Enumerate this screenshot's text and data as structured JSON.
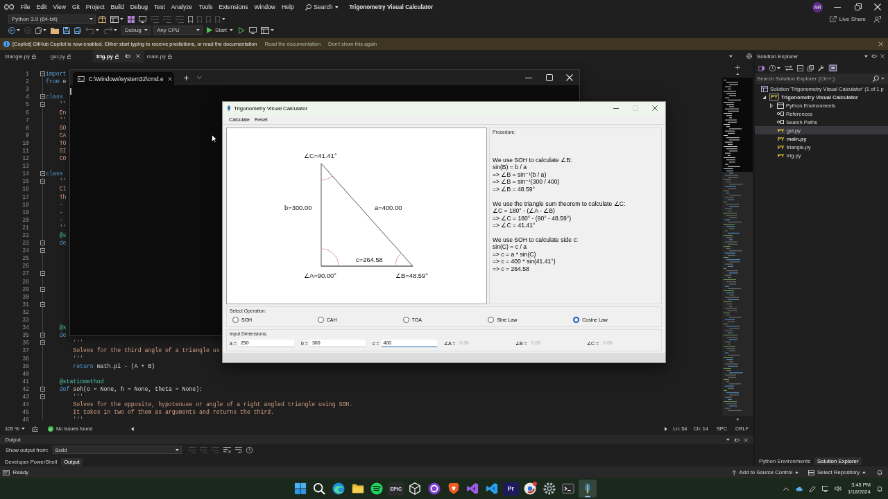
{
  "title_bar": {
    "menu": [
      "File",
      "Edit",
      "View",
      "Git",
      "Project",
      "Build",
      "Debug",
      "Test",
      "Analyze",
      "Tools",
      "Extensions",
      "Window",
      "Help"
    ],
    "search": "Search",
    "solution_name": "Trigonometry Visual Calculator",
    "account": "AR"
  },
  "toolbar": {
    "rows": [
      {
        "items": [
          {
            "kind": "dropdown",
            "label": "Python 3.9 (64-bit)",
            "disabled": false,
            "menu": true
          },
          {
            "kind": "package",
            "disabled": false,
            "menu": false
          },
          {
            "kind": "window",
            "disabled": false,
            "menu": true
          },
          {
            "kind": "grid",
            "disabled": false,
            "menu": false
          },
          {
            "kind": "monitor",
            "disabled": false,
            "menu": false
          },
          {
            "kind": "lines",
            "disabled": true,
            "menu": false
          },
          {
            "kind": "lines",
            "disabled": true,
            "menu": false
          },
          {
            "kind": "lines",
            "disabled": true,
            "menu": false
          },
          {
            "kind": "bookmark",
            "disabled": false,
            "menu": false
          },
          {
            "kind": "bookmark",
            "disabled": true,
            "menu": false
          },
          {
            "kind": "bookmark",
            "disabled": true,
            "menu": false
          },
          {
            "kind": "bookmark",
            "disabled": true,
            "menu": true
          }
        ]
      },
      {
        "items": [
          {
            "kind": "back",
            "disabled": false,
            "menu": true
          },
          {
            "kind": "forward",
            "disabled": true,
            "menu": false
          },
          {
            "kind": "docs",
            "disabled": false,
            "menu": true
          },
          {
            "kind": "folder",
            "disabled": false,
            "menu": false
          },
          {
            "kind": "save",
            "disabled": false,
            "menu": false
          },
          {
            "kind": "saveall",
            "disabled": false,
            "menu": false
          },
          {
            "kind": "undo",
            "disabled": true,
            "menu": true
          },
          {
            "kind": "redo",
            "disabled": true,
            "menu": true
          },
          {
            "kind": "dropdown",
            "label": "Debug",
            "disabled": false,
            "menu": true
          },
          {
            "kind": "dropdown",
            "label": "Any CPU",
            "disabled": false,
            "menu": true
          },
          {
            "kind": "start",
            "label": "Start",
            "disabled": false,
            "menu": true
          },
          {
            "kind": "run",
            "disabled": false,
            "menu": false
          },
          {
            "kind": "monitor",
            "disabled": false,
            "menu": false
          },
          {
            "kind": "window",
            "disabled": false,
            "menu": true
          }
        ]
      }
    ],
    "live_share": "Live Share"
  },
  "info_bar": {
    "message": "[Copilot] GitHub Copilot is now enabled. Either start typing to receive predictions, or read the documentation",
    "links": [
      "Read the documentation",
      "Don't show this again"
    ]
  },
  "document_tabs": [
    {
      "label": "triangle.py",
      "selected": false
    },
    {
      "label": "gui.py",
      "selected": false
    },
    {
      "label": "trig.py",
      "selected": true
    },
    {
      "label": "main.py",
      "selected": false
    }
  ],
  "editor": {
    "lines": [
      {
        "number": "1",
        "foldable": true,
        "tokens": [
          {
            "text": "import",
            "kind": "keyword"
          }
        ]
      },
      {
        "number": "2",
        "foldable": false,
        "tokens": [
          {
            "text": "from",
            "kind": "keyword"
          },
          {
            "text": " e",
            "kind": "plain"
          }
        ]
      },
      {
        "number": "3",
        "foldable": false
      },
      {
        "number": "4",
        "foldable": true,
        "tokens": [
          {
            "text": "class",
            "kind": "keyword"
          }
        ],
        "children": [
          {
            "number": "5",
            "foldable": true,
            "tokens": [
              {
                "text": "''",
                "kind": "string"
              }
            ]
          },
          {
            "number": "6",
            "foldable": false,
            "tokens": [
              {
                "text": "En",
                "kind": "string"
              }
            ]
          },
          {
            "number": "7",
            "foldable": false,
            "tokens": [
              {
                "text": "''",
                "kind": "string"
              }
            ]
          },
          {
            "number": "8",
            "foldable": false,
            "tokens": [
              {
                "text": "SO",
                "kind": "string"
              }
            ]
          },
          {
            "number": "9",
            "foldable": false,
            "tokens": [
              {
                "text": "CA",
                "kind": "string"
              }
            ]
          },
          {
            "number": "10",
            "foldable": false,
            "tokens": [
              {
                "text": "TO",
                "kind": "string"
              }
            ]
          },
          {
            "number": "11",
            "foldable": false,
            "tokens": [
              {
                "text": "SI",
                "kind": "string"
              }
            ]
          },
          {
            "number": "12",
            "foldable": false,
            "tokens": [
              {
                "text": "CO",
                "kind": "string"
              }
            ]
          }
        ]
      },
      {
        "number": "13",
        "foldable": false
      },
      {
        "number": "14",
        "foldable": true,
        "tokens": [
          {
            "text": "class",
            "kind": "keyword"
          }
        ],
        "children": [
          {
            "number": "15",
            "foldable": true,
            "tokens": [
              {
                "text": "''",
                "kind": "string"
              }
            ]
          },
          {
            "number": "16",
            "foldable": false,
            "tokens": [
              {
                "text": "Cl",
                "kind": "string"
              }
            ]
          },
          {
            "number": "17",
            "foldable": false,
            "tokens": [
              {
                "text": "Th",
                "kind": "string"
              }
            ]
          },
          {
            "number": "18",
            "foldable": false,
            "tokens": [
              {
                "text": "-",
                "kind": "string"
              }
            ]
          },
          {
            "number": "19",
            "foldable": false,
            "tokens": [
              {
                "text": "-",
                "kind": "string"
              }
            ]
          },
          {
            "number": "20",
            "foldable": false,
            "tokens": [
              {
                "text": "-",
                "kind": "string"
              }
            ]
          },
          {
            "number": "21",
            "foldable": false,
            "tokens": [
              {
                "text": "''",
                "kind": "string"
              }
            ]
          },
          {
            "number": "22",
            "foldable": false,
            "tokens": [
              {
                "text": "@s",
                "kind": "decorator"
              }
            ]
          },
          {
            "number": "23",
            "foldable": true,
            "tokens": [
              {
                "text": "de",
                "kind": "keyword"
              }
            ],
            "children": [
              {
                "number": "24",
                "foldable": true
              },
              {
                "number": "25",
                "foldable": false
              },
              {
                "number": "26",
                "foldable": false
              },
              {
                "number": "27",
                "foldable": true
              },
              {
                "number": "28",
                "foldable": false
              },
              {
                "number": "29",
                "foldable": true
              },
              {
                "number": "30",
                "foldable": false
              },
              {
                "number": "31",
                "foldable": true
              },
              {
                "number": "32",
                "foldable": false
              },
              {
                "number": "33",
                "foldable": false
              }
            ]
          },
          {
            "number": "34",
            "foldable": false,
            "tokens": [
              {
                "text": "@s",
                "kind": "decorator"
              }
            ]
          },
          {
            "number": "35",
            "foldable": true,
            "tokens": [
              {
                "text": "de",
                "kind": "keyword"
              }
            ],
            "children": [
              {
                "number": "36",
                "foldable": true,
                "tokens": [
                  {
                    "text": "'''",
                    "kind": "string"
                  }
                ]
              },
              {
                "number": "37",
                "foldable": false,
                "tokens": [
                  {
                    "text": "Solves for the third angle of a triangle us",
                    "kind": "string"
                  }
                ]
              },
              {
                "number": "38",
                "foldable": false,
                "tokens": [
                  {
                    "text": "'''",
                    "kind": "string"
                  }
                ]
              },
              {
                "number": "39",
                "foldable": false,
                "tokens": [
                  {
                    "text": "return",
                    "kind": "keyword"
                  },
                  {
                    "text": " math.pi - (A + B)",
                    "kind": "plain"
                  }
                ]
              }
            ]
          },
          {
            "number": "40",
            "foldable": false
          },
          {
            "number": "41",
            "foldable": false,
            "tokens": [
              {
                "text": "@staticmethod",
                "kind": "decorator"
              }
            ]
          },
          {
            "number": "42",
            "foldable": true,
            "tokens": [
              {
                "text": "def",
                "kind": "keyword"
              },
              {
                "text": " soh(o = None, h = None, theta = None):",
                "kind": "plain"
              }
            ],
            "children": [
              {
                "number": "43",
                "foldable": true,
                "tokens": [
                  {
                    "text": "'''",
                    "kind": "string"
                  }
                ]
              },
              {
                "number": "44",
                "foldable": false,
                "tokens": [
                  {
                    "text": "Solves for the opposite, hypotenuse or angle of a right angled triangle using SOH.",
                    "kind": "string"
                  }
                ]
              },
              {
                "number": "45",
                "foldable": false,
                "tokens": [
                  {
                    "text": "It takes in two of them as arguments and returns the third.",
                    "kind": "string"
                  }
                ]
              },
              {
                "number": "46",
                "foldable": false,
                "tokens": [
                  {
                    "text": "'''",
                    "kind": "string"
                  }
                ]
              }
            ]
          }
        ]
      }
    ]
  },
  "editor_status": {
    "zoom": "105 %",
    "issues": "No issues found",
    "line": "Ln: 54",
    "column": "Ch: 14",
    "indentation": "SPC",
    "line_ending": "CRLF"
  },
  "cmd_window": {
    "tab": "C:\\Windows\\system32\\cmd.e"
  },
  "calculator": {
    "title": "Trigonometry Visual Calculator",
    "controls": [
      {
        "kind": "minimize",
        "disabled": false
      },
      {
        "kind": "maximize",
        "disabled": true
      },
      {
        "kind": "close",
        "disabled": false
      }
    ],
    "menu": [
      "Calculate",
      "Reset"
    ],
    "diagram": {
      "angles": [
        "∠A=90.00°",
        "∠B=48.59°",
        "∠C=41.41°"
      ],
      "sides": [
        "a=400.00",
        "b=300.00",
        "c=264.58"
      ]
    },
    "procedure": {
      "label": "Procedure:",
      "blocks": [
        [
          "We use SOH to calculate ∠B:",
          "sin(B) = b / a",
          "=> ∠B = sin⁻¹(b / a)",
          "=> ∠B = sin⁻¹(300 / 400)",
          "=> ∠B = 48.59°"
        ],
        [
          "We use the triangle sum theorem to calculate ∠C:",
          "∠C = 180° - (∠A - ∠B)",
          "=> ∠C = 180° - (90° - 48.59°)",
          "=> ∠C = 41.41°"
        ],
        [
          "We use SOH to calculate side c:",
          "sin(C) = c / a",
          "=> c = a * sin(C)",
          "=> c = 400 * sin(41.41°)",
          "=> c = 264.58"
        ]
      ]
    },
    "operation": {
      "label": "Select Operation:",
      "options": [
        {
          "label": "SOH",
          "selected": false
        },
        {
          "label": "CAH",
          "selected": false
        },
        {
          "label": "TOA",
          "selected": false
        },
        {
          "label": "Sine Law",
          "selected": false
        },
        {
          "label": "Cosine Law",
          "selected": true
        }
      ]
    },
    "dimensions": {
      "label": "Input Dimensions:",
      "fields": [
        {
          "label": "a =",
          "value": "250",
          "focused": false,
          "disabled": false
        },
        {
          "label": "b =",
          "value": "300",
          "focused": false,
          "disabled": false
        },
        {
          "label": "c =",
          "value": "400",
          "focused": true,
          "disabled": false
        },
        {
          "label": "∠A =",
          "value": "0.00",
          "focused": false,
          "disabled": true
        },
        {
          "label": "∠B =",
          "value": "0.00",
          "focused": false,
          "disabled": true
        },
        {
          "label": "∠C =",
          "value": "0.00",
          "focused": false,
          "disabled": true
        }
      ]
    }
  },
  "output": {
    "title": "Output",
    "source_label": "Show output from:",
    "source": "Build",
    "tools": [
      {
        "kind": "lines",
        "disabled": true
      },
      {
        "kind": "lines",
        "disabled": true
      },
      {
        "kind": "lines",
        "disabled": true
      },
      {
        "kind": "clear",
        "disabled": false
      },
      {
        "kind": "wrap",
        "disabled": false
      },
      {
        "kind": "clock",
        "disabled": false
      }
    ],
    "tabs": [
      {
        "label": "Developer PowerShell",
        "selected": false
      },
      {
        "label": "Output",
        "selected": true
      }
    ]
  },
  "solution_explorer": {
    "title": "Solution Explorer",
    "tools": [
      {
        "kind": "solution",
        "on": false,
        "menu": false
      },
      {
        "kind": "history",
        "on": false,
        "menu": true
      },
      {
        "kind": "sync",
        "on": false,
        "menu": false
      },
      {
        "kind": "collapse",
        "on": false,
        "menu": false
      },
      {
        "kind": "pages",
        "on": false,
        "menu": false
      },
      {
        "kind": "wrench",
        "on": false,
        "menu": false
      },
      {
        "kind": "preview",
        "on": true,
        "menu": false
      }
    ],
    "search": {
      "placeholder": "Search Solution Explorer (Ctrl+;)"
    },
    "tree": [
      {
        "label": "Solution 'Trigonometry Visual Calculator' (1 of 1 p",
        "kind": "solution",
        "selected": false,
        "startup": false,
        "children": [
          {
            "label": "Trigonometry Visual Calculator",
            "kind": "project",
            "badge": "PY",
            "expanded": true,
            "selected": false,
            "startup": true,
            "children": [
              {
                "label": "Python Environments",
                "kind": "environments",
                "expanded": false,
                "selected": false,
                "startup": false
              },
              {
                "label": "References",
                "kind": "references",
                "selected": false,
                "startup": false
              },
              {
                "label": "Search Paths",
                "kind": "references",
                "selected": false,
                "startup": false
              },
              {
                "label": "gui.py",
                "kind": "file",
                "badge": "PY",
                "selected": true,
                "startup": false
              },
              {
                "label": "main.py",
                "kind": "file",
                "badge": "PY",
                "selected": false,
                "startup": true
              },
              {
                "label": "triangle.py",
                "kind": "file",
                "badge": "PY",
                "selected": false,
                "startup": false
              },
              {
                "label": "trig.py",
                "kind": "file",
                "badge": "PY",
                "selected": false,
                "startup": false
              }
            ]
          }
        ]
      }
    ],
    "tabs": [
      {
        "label": "Python Environments",
        "selected": false
      },
      {
        "label": "Solution Explorer",
        "selected": true
      }
    ]
  },
  "status_bar": {
    "status": "Ready",
    "source_control": "Add to Source Control",
    "repository": "Select Repository"
  },
  "taskbar": {
    "apps": [
      {
        "kind": "windows",
        "selected": false,
        "notification": false
      },
      {
        "kind": "search",
        "selected": false,
        "notification": false
      },
      {
        "kind": "swirl",
        "selected": false,
        "notification": false
      },
      {
        "kind": "folder",
        "selected": false,
        "notification": false
      },
      {
        "kind": "waves",
        "selected": false,
        "notification": false
      },
      {
        "kind": "tile",
        "text": "EPIC",
        "color": "#2b2b2b",
        "selected": false,
        "notification": false
      },
      {
        "kind": "cube",
        "selected": false,
        "notification": false
      },
      {
        "kind": "ring",
        "selected": false,
        "notification": false
      },
      {
        "kind": "shield",
        "selected": false,
        "notification": false
      },
      {
        "kind": "ide",
        "selected": false,
        "notification": false
      },
      {
        "kind": "editor",
        "selected": false,
        "notification": false
      },
      {
        "kind": "tile",
        "text": "Pr",
        "color": "#1c1a5c",
        "selected": false,
        "notification": false
      },
      {
        "kind": "orb",
        "selected": false,
        "notification": true
      },
      {
        "kind": "gear",
        "selected": false,
        "notification": false
      },
      {
        "kind": "terminal",
        "selected": false,
        "notification": false
      },
      {
        "kind": "feather",
        "selected": true,
        "notification": false
      }
    ],
    "clock": {
      "time": "3:45 PM",
      "date": "1/18/2024"
    }
  }
}
